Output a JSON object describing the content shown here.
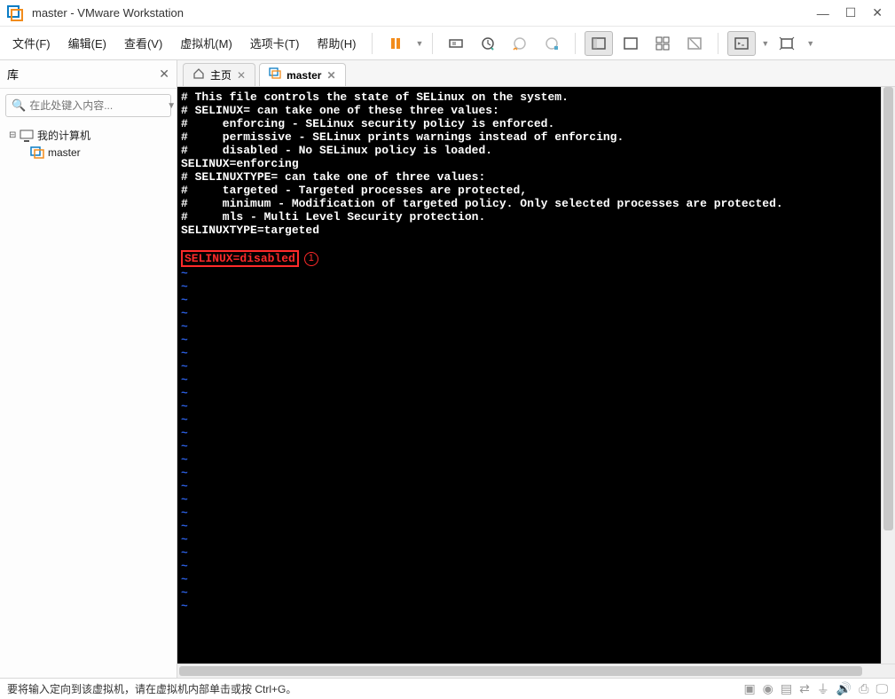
{
  "window": {
    "title": "master - VMware Workstation"
  },
  "menu": {
    "file": "文件(F)",
    "edit": "编辑(E)",
    "view": "查看(V)",
    "vm": "虚拟机(M)",
    "tabs": "选项卡(T)",
    "help": "帮助(H)"
  },
  "sidebar": {
    "title": "库",
    "search_placeholder": "在此处键入内容...",
    "root": "我的计算机",
    "child": "master"
  },
  "tabs": {
    "home": "主页",
    "vm": "master"
  },
  "terminal": {
    "lines": [
      "# This file controls the state of SELinux on the system.",
      "# SELINUX= can take one of these three values:",
      "#     enforcing - SELinux security policy is enforced.",
      "#     permissive - SELinux prints warnings instead of enforcing.",
      "#     disabled - No SELinux policy is loaded.",
      "SELINUX=enforcing",
      "# SELINUXTYPE= can take one of three values:",
      "#     targeted - Targeted processes are protected,",
      "#     minimum - Modification of targeted policy. Only selected processes are protected.",
      "#     mls - Multi Level Security protection.",
      "SELINUXTYPE=targeted"
    ],
    "highlighted": "SELINUX=disabled",
    "annotation_number": "1"
  },
  "status": {
    "message": "要将输入定向到该虚拟机，请在虚拟机内部单击或按 Ctrl+G。"
  }
}
